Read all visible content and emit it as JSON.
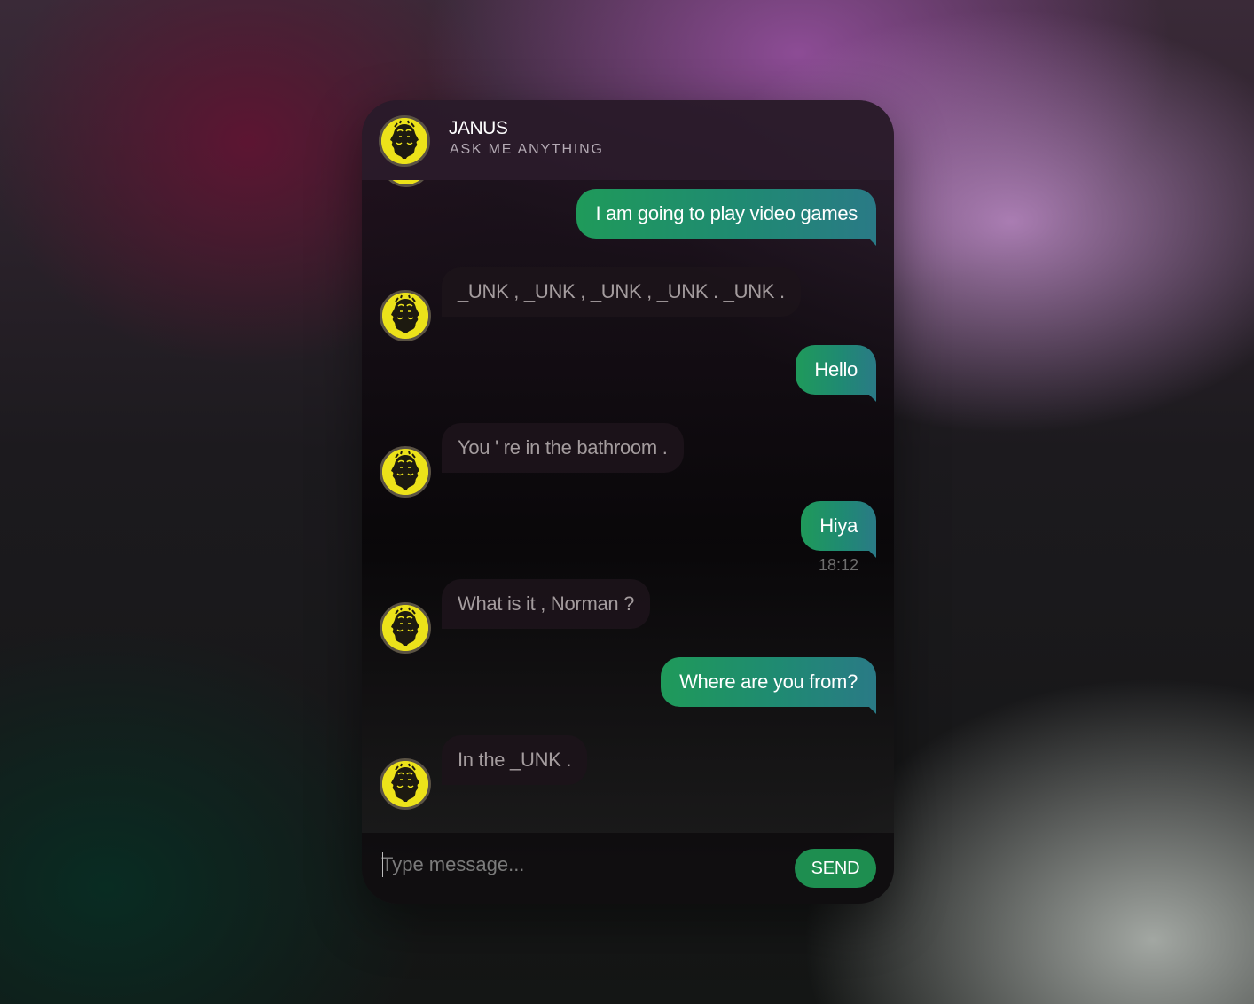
{
  "header": {
    "title": "JANUS",
    "subtitle": "ASK ME ANYTHING",
    "avatar_icon": "janus-two-faced-head-icon"
  },
  "messages": [
    {
      "sender": "user",
      "text": "I am going to play video games"
    },
    {
      "sender": "bot",
      "text": "_UNK , _UNK , _UNK , _UNK . _UNK ."
    },
    {
      "sender": "user",
      "text": "Hello"
    },
    {
      "sender": "bot",
      "text": "You ' re in the bathroom ."
    },
    {
      "sender": "user",
      "text": "Hiya",
      "time": "18:12"
    },
    {
      "sender": "bot",
      "text": "What is it , Norman ?"
    },
    {
      "sender": "user",
      "text": "Where are you from?"
    },
    {
      "sender": "bot",
      "text": "In the _UNK ."
    }
  ],
  "composer": {
    "placeholder": "Type message...",
    "send_label": "SEND"
  },
  "colors": {
    "user_bubble_start": "#1f9a5a",
    "user_bubble_end": "#2a7a86",
    "send_button": "#1e8e50",
    "avatar_background": "#ece21a"
  }
}
